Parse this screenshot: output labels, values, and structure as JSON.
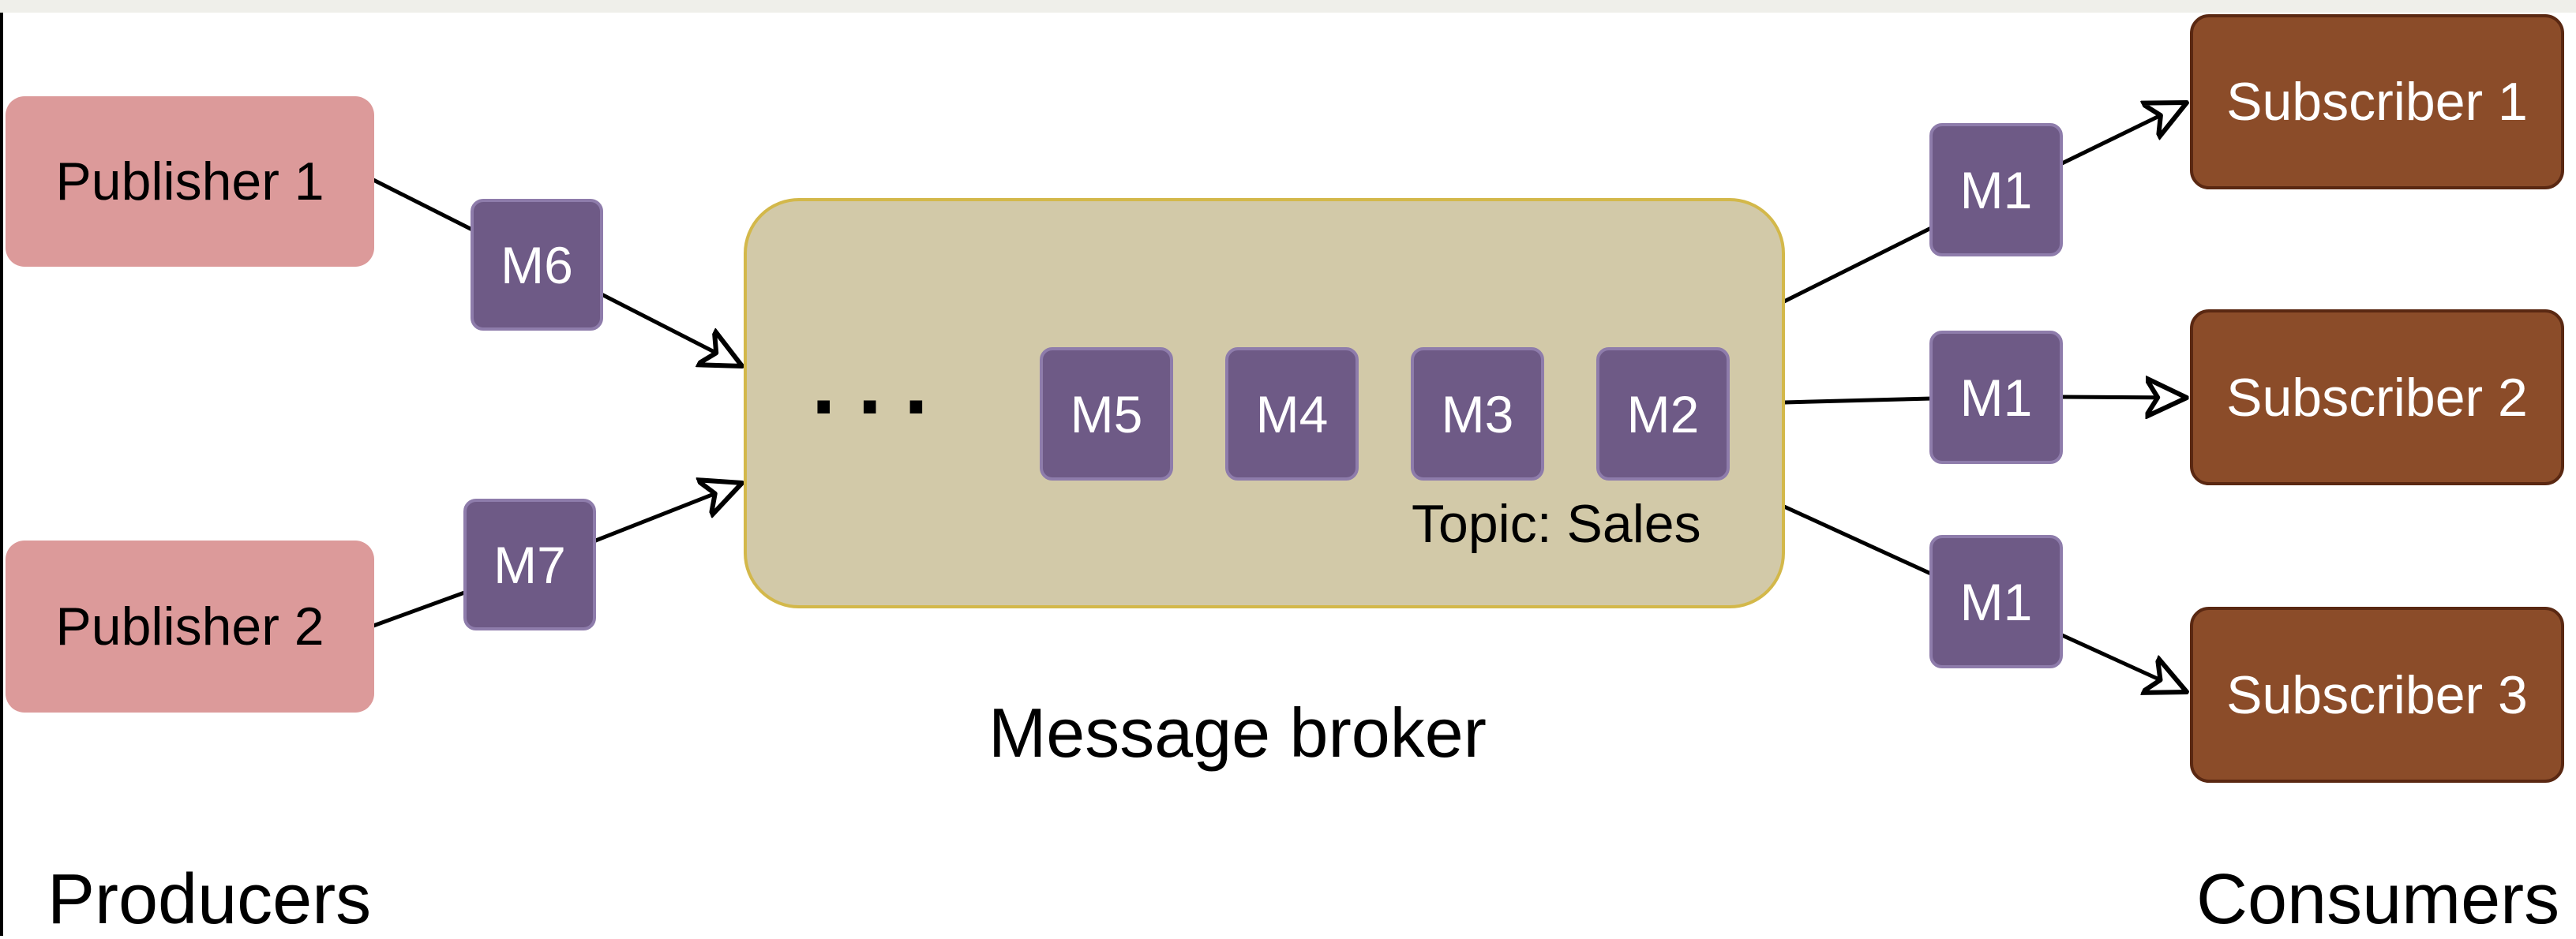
{
  "publishers": [
    {
      "label": "Publisher 1"
    },
    {
      "label": "Publisher 2"
    }
  ],
  "subscribers": [
    {
      "label": "Subscriber 1"
    },
    {
      "label": "Subscriber 2"
    },
    {
      "label": "Subscriber 3"
    }
  ],
  "inbound_messages": [
    {
      "label": "M6"
    },
    {
      "label": "M7"
    }
  ],
  "broker": {
    "queue_ellipsis": "...",
    "queue": [
      {
        "label": "M5"
      },
      {
        "label": "M4"
      },
      {
        "label": "M3"
      },
      {
        "label": "M2"
      }
    ],
    "topic_label": "Topic: Sales",
    "caption": "Message broker"
  },
  "outbound_messages": [
    {
      "label": "M1"
    },
    {
      "label": "M1"
    },
    {
      "label": "M1"
    }
  ],
  "section_labels": {
    "producers": "Producers",
    "consumers": "Consumers"
  },
  "colors": {
    "publisher_fill": "#dc9a9a",
    "subscriber_fill": "#8b4c29",
    "broker_fill": "#d2c9a8",
    "broker_border": "#d3b84a",
    "message_fill": "#6e5a86"
  }
}
